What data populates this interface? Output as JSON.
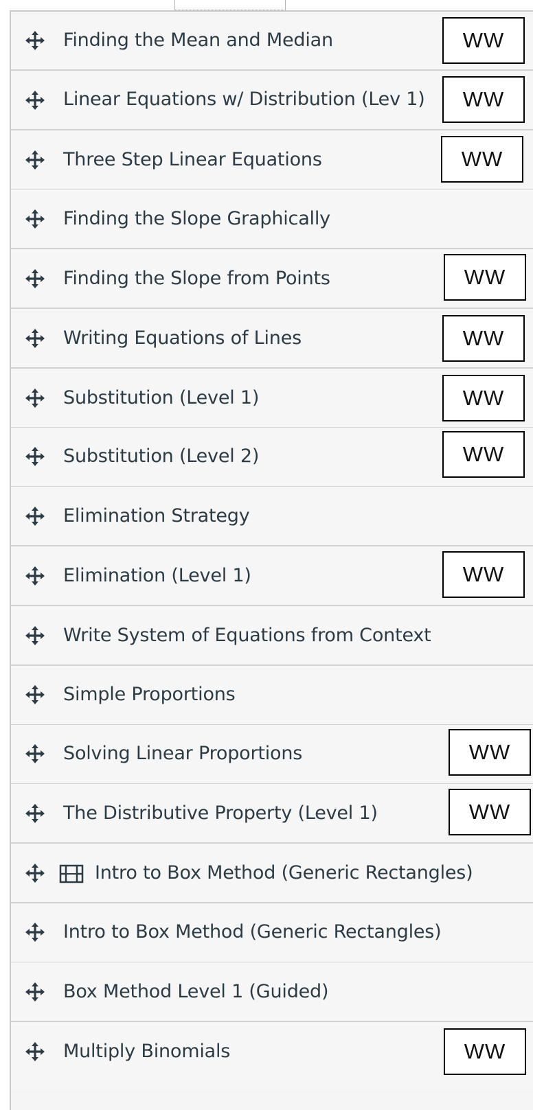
{
  "modules": {
    "items": [
      {
        "title": "Finding the Mean and Median",
        "badge": "WW",
        "has_video_icon": false,
        "drag_icon": "move-arrows-icon"
      },
      {
        "title": "Linear Equations w/ Distribution (Lev 1)",
        "badge": "WW",
        "has_video_icon": false,
        "drag_icon": "move-arrows-icon"
      },
      {
        "title": "Three Step Linear Equations",
        "badge": "WW",
        "has_video_icon": false,
        "drag_icon": "move-arrows-icon"
      },
      {
        "title": "Finding the Slope Graphically",
        "badge": "",
        "has_video_icon": false,
        "drag_icon": "move-arrows-icon"
      },
      {
        "title": "Finding the Slope from Points",
        "badge": "WW",
        "has_video_icon": false,
        "drag_icon": "move-arrows-icon"
      },
      {
        "title": "Writing Equations of Lines",
        "badge": "WW",
        "has_video_icon": false,
        "drag_icon": "move-arrows-icon"
      },
      {
        "title": "Substitution (Level 1)",
        "badge": "WW",
        "has_video_icon": false,
        "drag_icon": "move-arrows-icon"
      },
      {
        "title": "Substitution (Level 2)",
        "badge": "WW",
        "has_video_icon": false,
        "drag_icon": "move-arrows-icon"
      },
      {
        "title": "Elimination Strategy",
        "badge": "",
        "has_video_icon": false,
        "drag_icon": "move-arrows-icon"
      },
      {
        "title": "Elimination (Level 1)",
        "badge": "WW",
        "has_video_icon": false,
        "drag_icon": "move-arrows-icon"
      },
      {
        "title": "Write System of Equations from Context",
        "badge": "",
        "has_video_icon": false,
        "drag_icon": "move-arrows-icon"
      },
      {
        "title": "Simple Proportions",
        "badge": "",
        "has_video_icon": false,
        "drag_icon": "move-arrows-icon"
      },
      {
        "title": "Solving Linear Proportions",
        "badge": "WW",
        "has_video_icon": false,
        "drag_icon": "move-arrows-icon"
      },
      {
        "title": "The Distributive Property (Level 1)",
        "badge": "WW",
        "has_video_icon": false,
        "drag_icon": "move-arrows-icon"
      },
      {
        "title": "Intro to Box Method (Generic Rectangles)",
        "badge": "",
        "has_video_icon": true,
        "drag_icon": "move-arrows-icon",
        "type_icon": "video-film-icon"
      },
      {
        "title": "Intro to Box Method (Generic Rectangles)",
        "badge": "",
        "has_video_icon": false,
        "drag_icon": "move-arrows-icon"
      },
      {
        "title": "Box Method Level 1 (Guided)",
        "badge": "",
        "has_video_icon": false,
        "drag_icon": "move-arrows-icon"
      },
      {
        "title": "Multiply Binomials",
        "badge": "WW",
        "has_video_icon": false,
        "drag_icon": "move-arrows-icon"
      }
    ]
  },
  "colors": {
    "row_background": "#f6f6f6",
    "divider": "#d2d2d2",
    "text": "#2d3b45",
    "badge_border": "#000000",
    "badge_background": "#ffffff"
  }
}
